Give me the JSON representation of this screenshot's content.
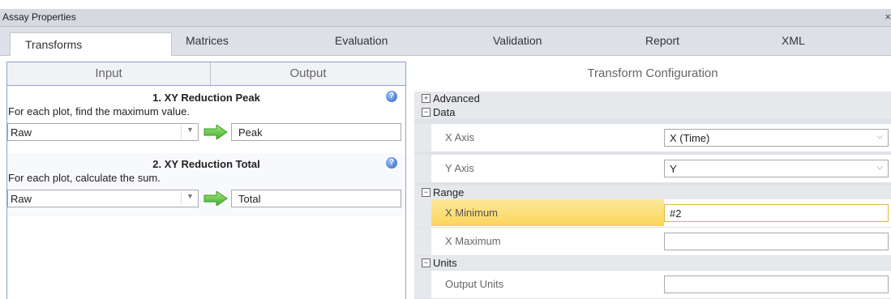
{
  "window": {
    "title": "Assay Properties",
    "close": "×"
  },
  "tabs": [
    "Transforms",
    "Matrices",
    "Evaluation",
    "Validation",
    "Report",
    "XML"
  ],
  "left": {
    "input_label": "Input",
    "output_label": "Output",
    "transforms": [
      {
        "title": "1. XY Reduction Peak",
        "description": "For each plot, find the maximum value.",
        "input": "Raw",
        "output": "Peak"
      },
      {
        "title": "2. XY Reduction Total",
        "description": "For each plot, calculate the sum.",
        "input": "Raw",
        "output": "Total"
      }
    ]
  },
  "config": {
    "heading": "Transform Configuration",
    "categories": {
      "advanced": {
        "toggle": "+",
        "label": "Advanced"
      },
      "data": {
        "toggle": "−",
        "label": "Data"
      },
      "range": {
        "toggle": "−",
        "label": "Range"
      },
      "units": {
        "toggle": "−",
        "label": "Units"
      }
    },
    "props": {
      "x_axis": {
        "name": "X Axis",
        "value": "X (Time)"
      },
      "y_axis": {
        "name": "Y Axis",
        "value": "Y"
      },
      "x_min": {
        "name": "X Minimum",
        "value": "#2"
      },
      "x_max": {
        "name": "X Maximum",
        "value": ""
      },
      "output_units": {
        "name": "Output Units",
        "value": ""
      }
    }
  },
  "icons": {
    "help": "help-icon",
    "arrow": "right-arrow-icon",
    "dropdown": "chevron-down-icon"
  },
  "colors": {
    "selected_row": "#fbd45a",
    "arrow": "#5cc43a",
    "panel_border": "#8aa4c8"
  }
}
